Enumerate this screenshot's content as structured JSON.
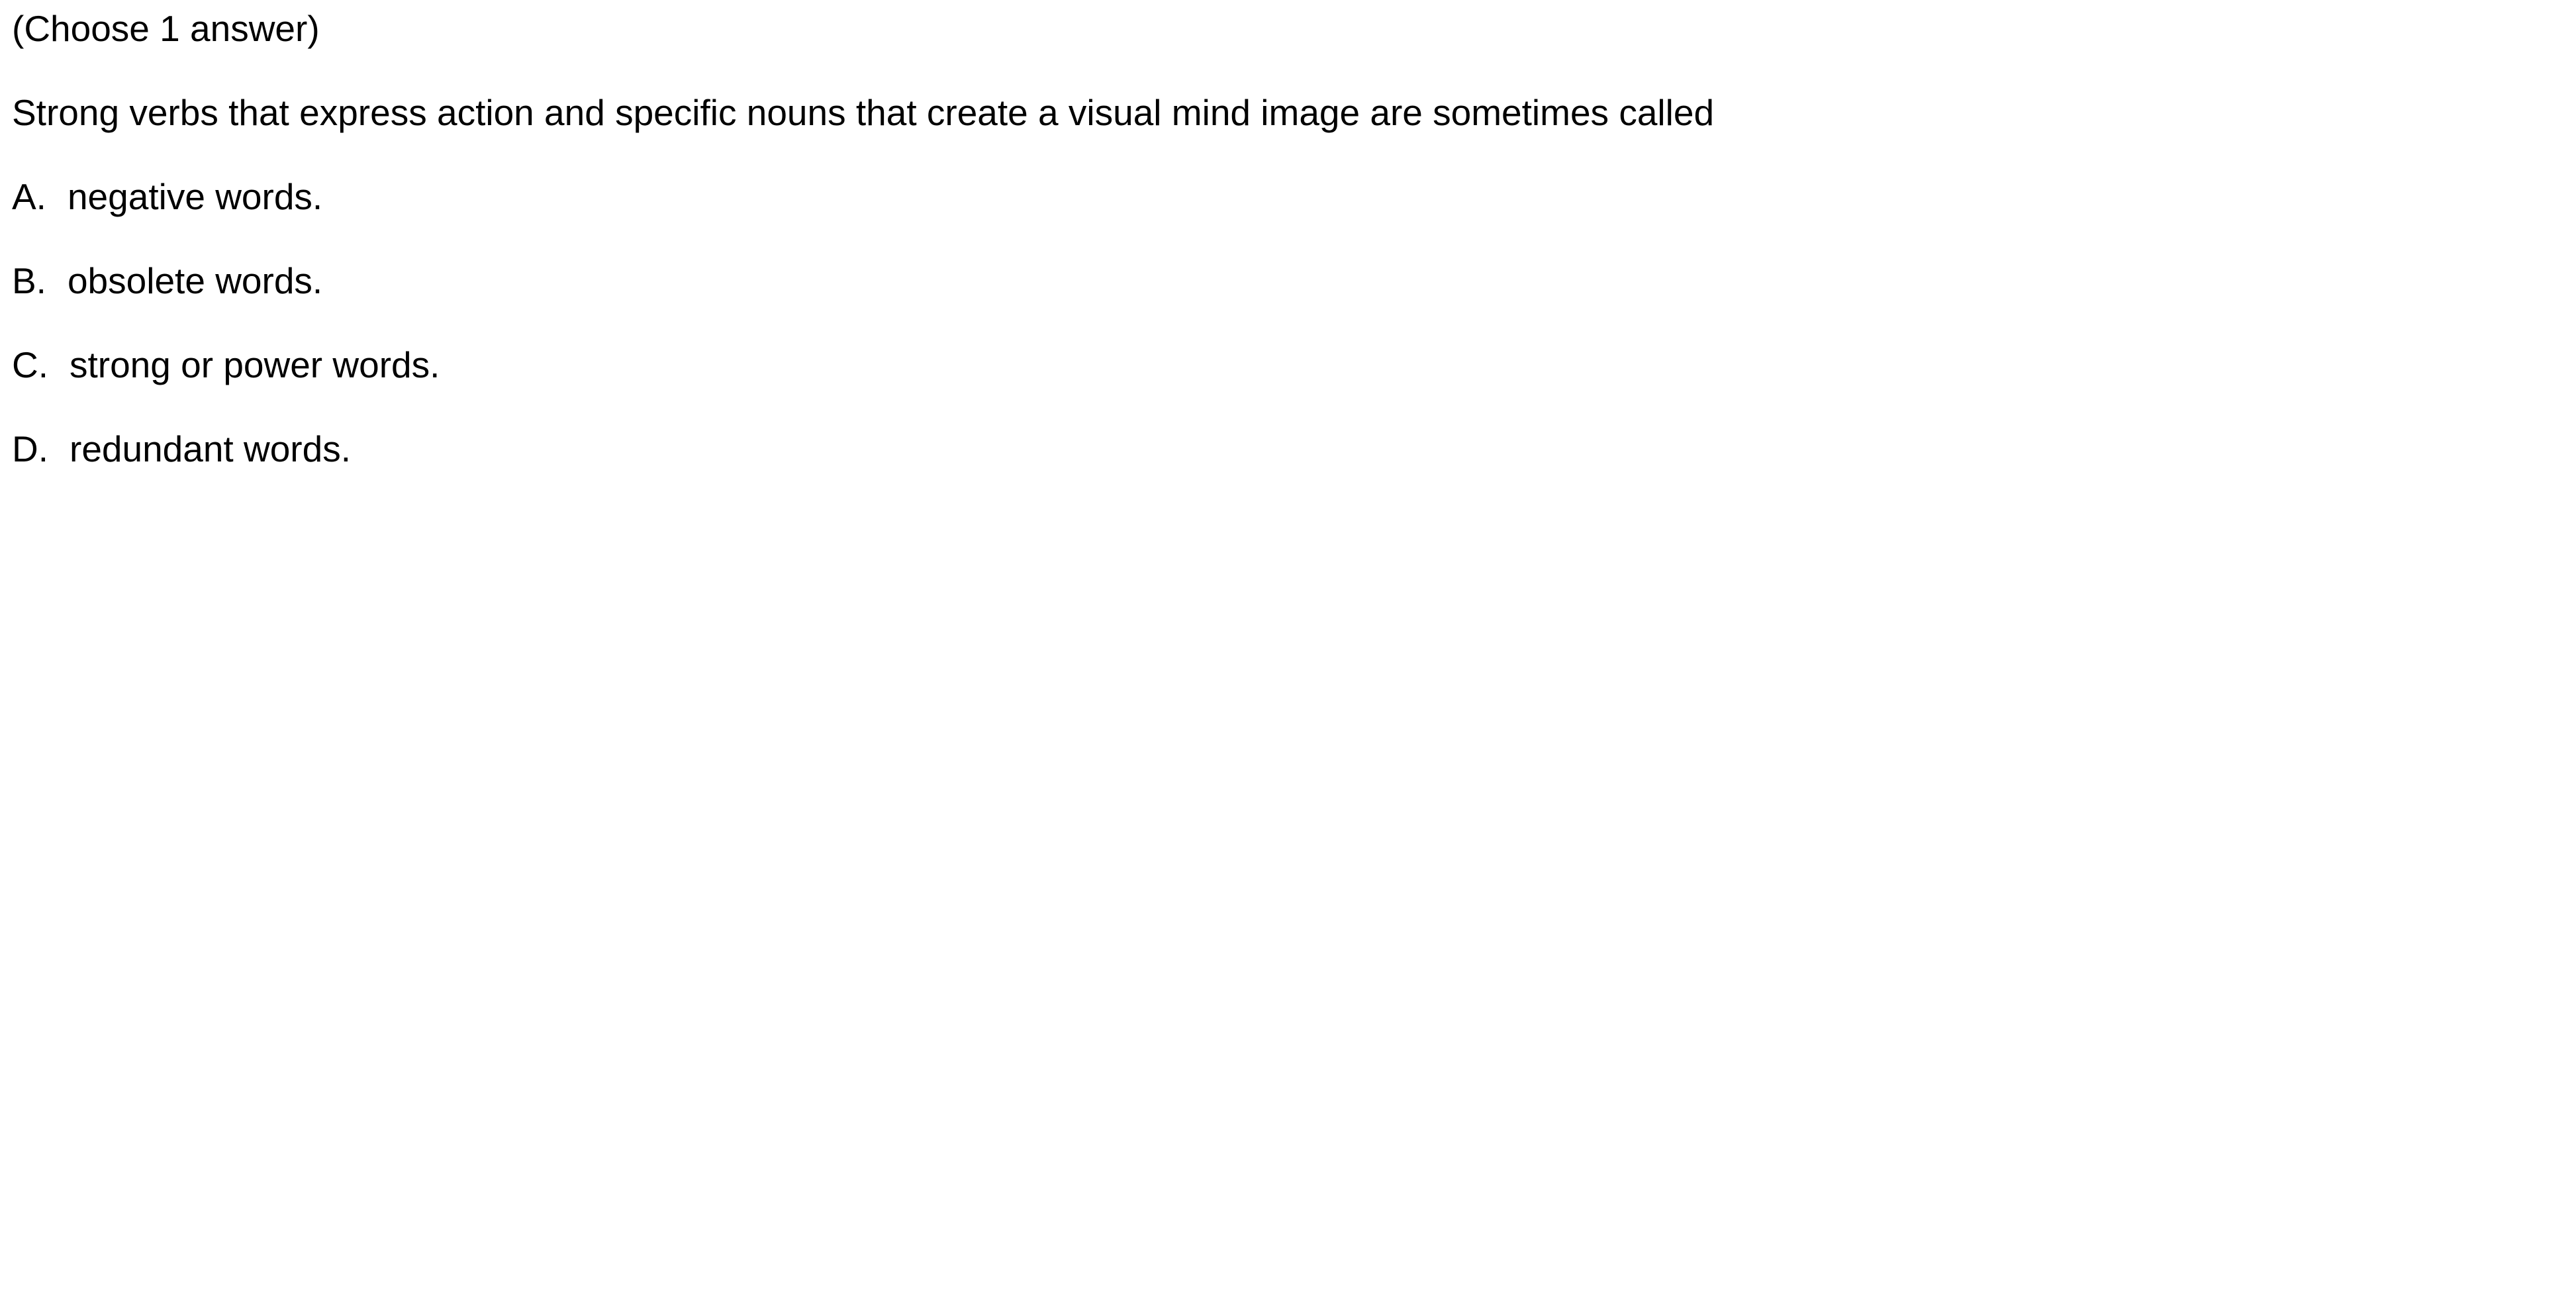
{
  "instruction": "(Choose 1 answer)",
  "question": "Strong verbs that express action and specific nouns that create a visual mind image are sometimes called",
  "options": [
    {
      "letter": "A.",
      "text": "negative words."
    },
    {
      "letter": "B.",
      "text": "obsolete words."
    },
    {
      "letter": "C.",
      "text": "strong or power words."
    },
    {
      "letter": "D.",
      "text": "redundant words."
    }
  ]
}
